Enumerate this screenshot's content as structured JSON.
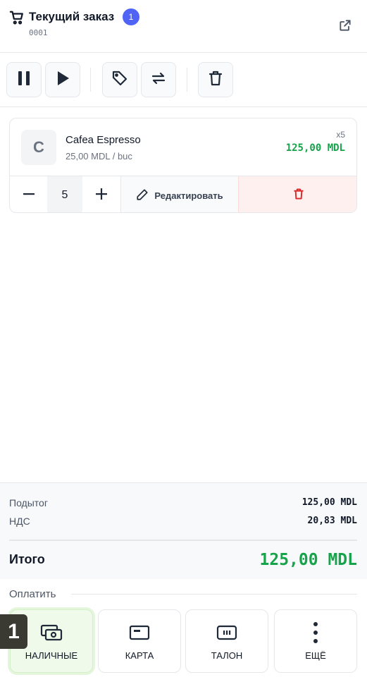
{
  "header": {
    "title": "Текущий заказ",
    "badge_count": "1",
    "order_number": "0001"
  },
  "toolbar": {
    "buttons": [
      {
        "name": "pause",
        "icon": "pause-icon"
      },
      {
        "name": "play",
        "icon": "play-icon"
      },
      {
        "name": "discount",
        "icon": "tag-icon"
      },
      {
        "name": "transfer",
        "icon": "swap-icon"
      },
      {
        "name": "clear",
        "icon": "trash-icon"
      }
    ]
  },
  "order": {
    "items": [
      {
        "initial": "C",
        "name": "Cafea Espresso",
        "unit_price": "25,00 MDL / buc",
        "qty_label": "x5",
        "total": "125,00 MDL",
        "quantity": "5",
        "edit_label": "Редактировать"
      }
    ]
  },
  "summary": {
    "subtotal_label": "Подытог",
    "subtotal_value": "125,00 MDL",
    "vat_label": "НДС",
    "vat_value": "20,83 MDL",
    "total_label": "Итого",
    "total_value": "125,00 MDL"
  },
  "payment": {
    "section_label": "Оплатить",
    "hotkey": "1",
    "methods": [
      {
        "label": "НАЛИЧНЫЕ",
        "icon": "cash-icon",
        "selected": true
      },
      {
        "label": "КАРТА",
        "icon": "card-icon",
        "selected": false
      },
      {
        "label": "ТАЛОН",
        "icon": "voucher-icon",
        "selected": false
      },
      {
        "label": "ЕЩЁ",
        "icon": "more-icon",
        "selected": false
      }
    ]
  },
  "colors": {
    "accent": "#4f63f5",
    "positive": "#16a34a",
    "danger": "#dc2626",
    "selected_bg": "#effaea"
  }
}
